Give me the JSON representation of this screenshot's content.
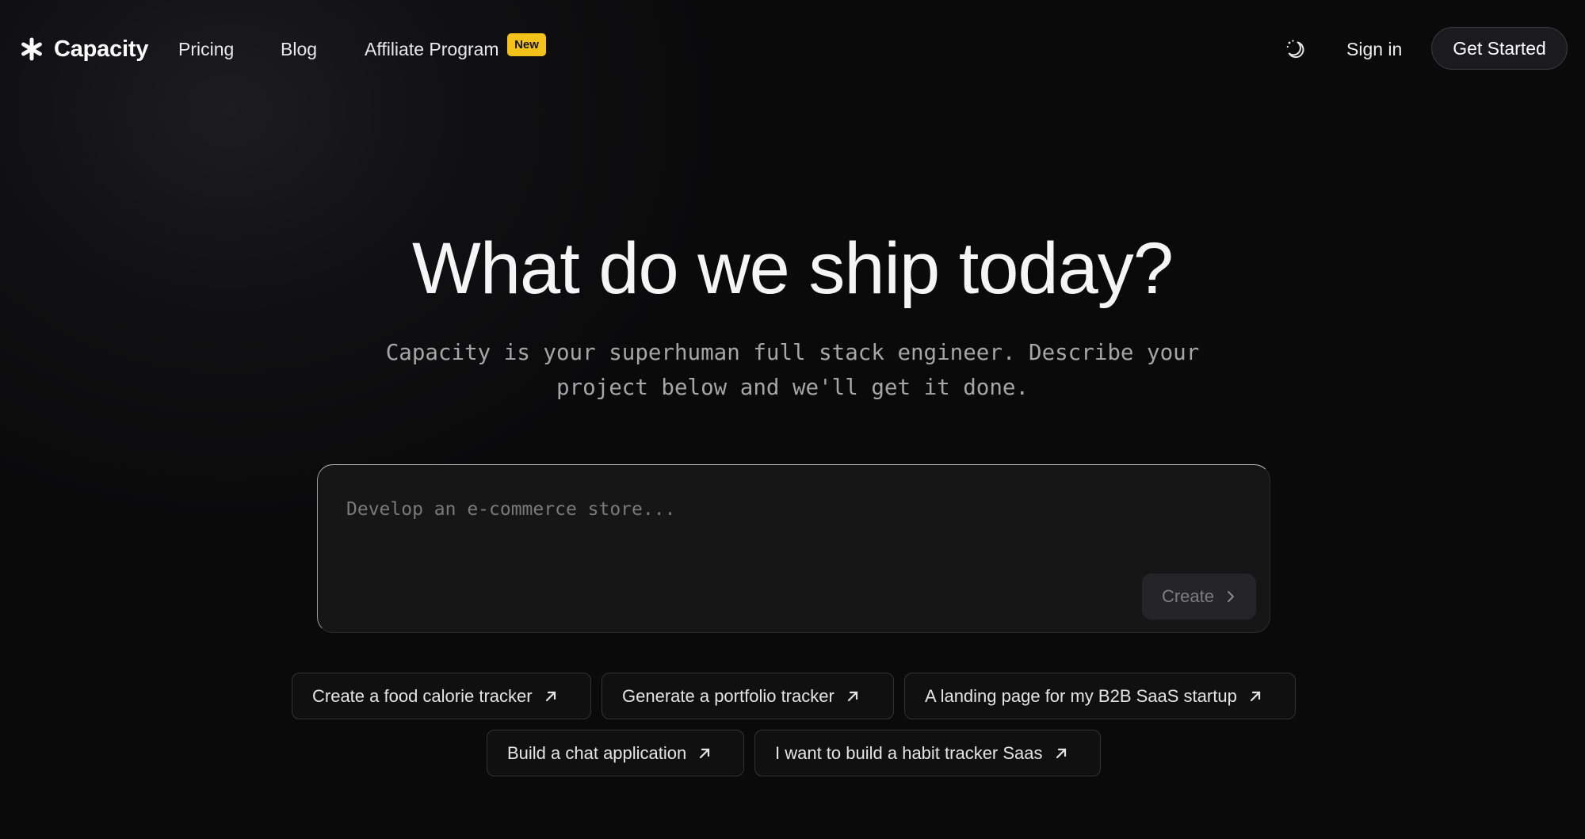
{
  "nav": {
    "brand": "Capacity",
    "links": [
      {
        "label": "Pricing"
      },
      {
        "label": "Blog"
      },
      {
        "label": "Affiliate Program",
        "badge": "New"
      }
    ],
    "sign_in": "Sign in",
    "get_started": "Get Started",
    "theme_toggle_icon": "moon-icon"
  },
  "hero": {
    "headline": "What do we ship today?",
    "subtitle_line1": "Capacity is your superhuman full stack engineer. Describe your",
    "subtitle_line2": "project below and we'll get it done."
  },
  "prompt": {
    "placeholder": "Develop an e-commerce store...",
    "value": "",
    "create_label": "Create"
  },
  "suggestions": [
    {
      "label": "Create a food calorie tracker"
    },
    {
      "label": "Generate a portfolio tracker"
    },
    {
      "label": "A landing page for my B2B SaaS startup"
    },
    {
      "label": "Build a chat application"
    },
    {
      "label": "I want to build a habit tracker Saas"
    }
  ],
  "colors": {
    "background": "#0a0a0b",
    "badge": "#f2c21a",
    "text": "#f5f5f5",
    "muted": "#a6a6a6"
  }
}
